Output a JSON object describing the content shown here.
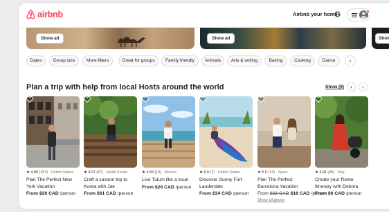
{
  "header": {
    "logo_text": "airbnb",
    "host_link": "Airbnb your home"
  },
  "hero": {
    "show_all_label": "Show all"
  },
  "filters": [
    "Dates",
    "Group size",
    "More filters",
    "Great for groups",
    "Family friendly",
    "Animals",
    "Arts & writing",
    "Baking",
    "Cooking",
    "Dance"
  ],
  "section": {
    "title": "Plan a trip with help from local Hosts around the world",
    "show_label": "Show (9)"
  },
  "cards": [
    {
      "rating": "★ 4.99",
      "reviews": "(157)",
      "location": "· United States",
      "title": "Plan The Perfect New York Vacation",
      "price": "From $26 CAD",
      "unit": " /person"
    },
    {
      "rating": "★ 4.97",
      "reviews": "(67)",
      "location": "· South Korea",
      "title": "Craft a custom trip to Korea with Jae",
      "price": "From $61 CAD",
      "unit": " /person"
    },
    {
      "rating": "★ 4.69",
      "reviews": "(13)",
      "location": "· Mexico",
      "title": "Live Tulum like a local",
      "price": "From $26 CAD",
      "unit": " /person"
    },
    {
      "rating": "★ 5.0",
      "reviews": "(7)",
      "location": "· United States",
      "title": "Discover Sunny Fort Lauderdale",
      "price": "From $34 CAD",
      "unit": " /person"
    },
    {
      "rating": "★ 5.0",
      "reviews": "(14)",
      "location": "· Spain",
      "title": "Plan The Perfect Barcelona Vacation",
      "price_prefix": "From ",
      "price_old": "$22 CAD",
      "price": " $18 CAD",
      "unit": " /person",
      "extra": "Show all prices"
    },
    {
      "rating": "★ 4.91",
      "reviews": "(45)",
      "location": "· Italy",
      "title": "Create your Rome itinerary with Debora",
      "price": "From $6 CAD",
      "unit": " /person"
    }
  ],
  "colors": {
    "brand": "#ff385c",
    "text": "#222222",
    "muted": "#717171",
    "chip_border": "#dddddd"
  },
  "icons": [
    "airbnb-logo-icon",
    "globe-icon",
    "menu-icon",
    "avatar-icon",
    "heart-icon",
    "chevron-left-icon",
    "chevron-right-icon"
  ]
}
